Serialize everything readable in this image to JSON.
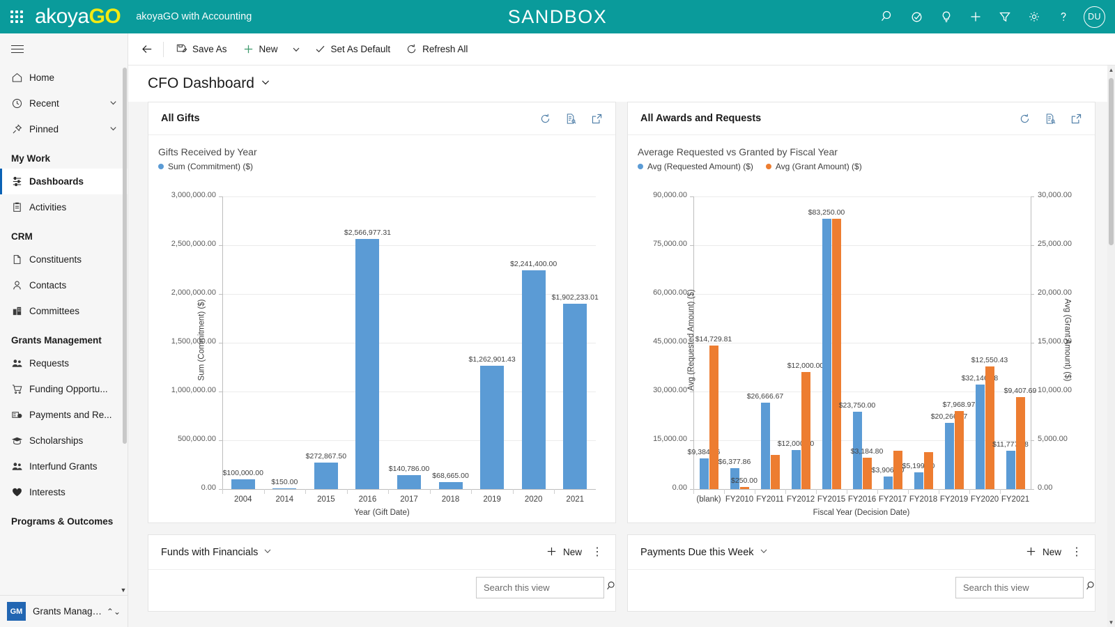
{
  "topbar": {
    "brand_white": "akoya",
    "brand_yellow": "GO",
    "app_title": "akoyaGO with Accounting",
    "environment_banner": "SANDBOX",
    "avatar_initials": "DU",
    "icons": [
      {
        "name": "search-icon",
        "label": "Search"
      },
      {
        "name": "check-circle-icon",
        "label": "Diagnostics"
      },
      {
        "name": "lightbulb-icon",
        "label": "Insights"
      },
      {
        "name": "plus-icon",
        "label": "Quick create"
      },
      {
        "name": "filter-icon",
        "label": "Filter"
      },
      {
        "name": "gear-icon",
        "label": "Settings"
      },
      {
        "name": "help-icon",
        "label": "Help"
      }
    ]
  },
  "commandbar": {
    "back": "Back",
    "save_as": "Save As",
    "new": "New",
    "set_as_default": "Set As Default",
    "refresh_all": "Refresh All"
  },
  "page": {
    "title": "CFO Dashboard"
  },
  "sidebar": {
    "top": [
      {
        "label": "Home",
        "icon": "home-icon",
        "chevron": false
      },
      {
        "label": "Recent",
        "icon": "clock-icon",
        "chevron": true
      },
      {
        "label": "Pinned",
        "icon": "pin-icon",
        "chevron": true
      }
    ],
    "groups": [
      {
        "title": "My Work",
        "items": [
          {
            "label": "Dashboards",
            "icon": "dashboard-icon",
            "selected": true
          },
          {
            "label": "Activities",
            "icon": "clipboard-icon",
            "selected": false
          }
        ]
      },
      {
        "title": "CRM",
        "items": [
          {
            "label": "Constituents",
            "icon": "page-icon",
            "selected": false
          },
          {
            "label": "Contacts",
            "icon": "person-icon",
            "selected": false
          },
          {
            "label": "Committees",
            "icon": "committee-icon",
            "selected": false
          }
        ]
      },
      {
        "title": "Grants Management",
        "items": [
          {
            "label": "Requests",
            "icon": "people-icon",
            "selected": false
          },
          {
            "label": "Funding Opportu...",
            "icon": "cart-icon",
            "selected": false
          },
          {
            "label": "Payments and Re...",
            "icon": "money-icon",
            "selected": false
          },
          {
            "label": "Scholarships",
            "icon": "graduation-icon",
            "selected": false
          },
          {
            "label": "Interfund Grants",
            "icon": "people-icon",
            "selected": false
          },
          {
            "label": "Interests",
            "icon": "heart-icon",
            "selected": false
          }
        ]
      },
      {
        "title": "Programs & Outcomes",
        "items": []
      }
    ],
    "footer": {
      "badge": "GM",
      "label": "Grants Managem..."
    }
  },
  "cards": {
    "all_gifts": {
      "title": "All Gifts",
      "actions": [
        "refresh-icon",
        "view-records-icon",
        "popout-icon"
      ]
    },
    "all_awards": {
      "title": "All Awards and Requests",
      "actions": [
        "refresh-icon",
        "view-records-icon",
        "popout-icon"
      ]
    },
    "funds": {
      "title": "Funds with Financials",
      "new_label": "New",
      "search_placeholder": "Search this view",
      "search_value": ""
    },
    "payments": {
      "title": "Payments Due this Week",
      "new_label": "New",
      "search_placeholder": "Search this view",
      "search_value": ""
    }
  },
  "colors": {
    "teal": "#0a9b9b",
    "brand_yellow": "#f2ea12",
    "series_blue": "#5b9bd5",
    "series_orange": "#ed7d31",
    "accent_blue": "#0b62b5"
  },
  "chart_data": [
    {
      "type": "bar",
      "title": "Gifts Received by Year",
      "xlabel": "Year (Gift Date)",
      "ylabel": "Sum (Commitment) ($)",
      "ylim": [
        0,
        3000000
      ],
      "yticks": [
        "0.00",
        "500,000.00",
        "1,000,000.00",
        "1,500,000.00",
        "2,000,000.00",
        "2,500,000.00",
        "3,000,000.00"
      ],
      "grid": true,
      "legend": [
        {
          "name": "Sum (Commitment) ($)",
          "color": "#5b9bd5"
        }
      ],
      "categories": [
        "2004",
        "2014",
        "2015",
        "2016",
        "2017",
        "2018",
        "2019",
        "2020",
        "2021"
      ],
      "values": [
        100000.0,
        150.0,
        272867.5,
        2566977.31,
        140786.0,
        68665.0,
        1262901.43,
        2241400.0,
        1902233.01
      ],
      "labels": [
        "$100,000.00",
        "$150.00",
        "$272,867.50",
        "$2,566,977.31",
        "$140,786.00",
        "$68,665.00",
        "$1,262,901.43",
        "$2,241,400.00",
        "$1,902,233.01"
      ]
    },
    {
      "type": "bar",
      "title": "Average Requested vs Granted by Fiscal Year",
      "xlabel": "Fiscal Year (Decision Date)",
      "ylabel": "Avg (Requested Amount) ($)",
      "ylabel_right": "Avg (Grant Amount) ($)",
      "ylim": [
        0,
        90000
      ],
      "ylim_right": [
        0,
        30000
      ],
      "yticks": [
        "0.00",
        "15,000.00",
        "30,000.00",
        "45,000.00",
        "60,000.00",
        "75,000.00",
        "90,000.00"
      ],
      "yticks_right": [
        "0.00",
        "5,000.00",
        "10,000.00",
        "15,000.00",
        "20,000.00",
        "25,000.00",
        "30,000.00"
      ],
      "grid": true,
      "legend": [
        {
          "name": "Avg (Requested Amount) ($)",
          "color": "#5b9bd5"
        },
        {
          "name": "Avg (Grant Amount) ($)",
          "color": "#ed7d31"
        }
      ],
      "categories": [
        "(blank)",
        "FY2010",
        "FY2011",
        "FY2012",
        "FY2015",
        "FY2016",
        "FY2017",
        "FY2018",
        "FY2019",
        "FY2020",
        "FY2021"
      ],
      "series": [
        {
          "name": "Avg (Requested Amount) ($)",
          "axis": "left",
          "color": "#5b9bd5",
          "values": [
            9384.56,
            6377.86,
            26666.67,
            12000.0,
            83250.0,
            23750.0,
            3906.3,
            5199.7,
            20266.67,
            32146.38,
            11777.78
          ],
          "labels": [
            "$9,384.56",
            "$6,377.86",
            "$26,666.67",
            "$12,000.00",
            "$83,250.00",
            "$23,750.00",
            "$3,906.30",
            "$5,199.70",
            "$20,266.67",
            "$32,146.38",
            "$11,777.78"
          ]
        },
        {
          "name": "Avg (Grant Amount) ($)",
          "axis": "right",
          "color": "#ed7d31",
          "values": [
            14729.81,
            250.0,
            3500.0,
            12000.0,
            27750.0,
            3184.8,
            3906.3,
            3800.0,
            7968.97,
            12550.43,
            9407.69
          ],
          "labels": [
            "$14,729.81",
            "$250.00",
            "",
            "$12,000.00",
            "",
            "$3,184.80",
            "",
            "",
            "$7,968.97",
            "$12,550.43",
            "$9,407.69"
          ]
        }
      ]
    }
  ]
}
